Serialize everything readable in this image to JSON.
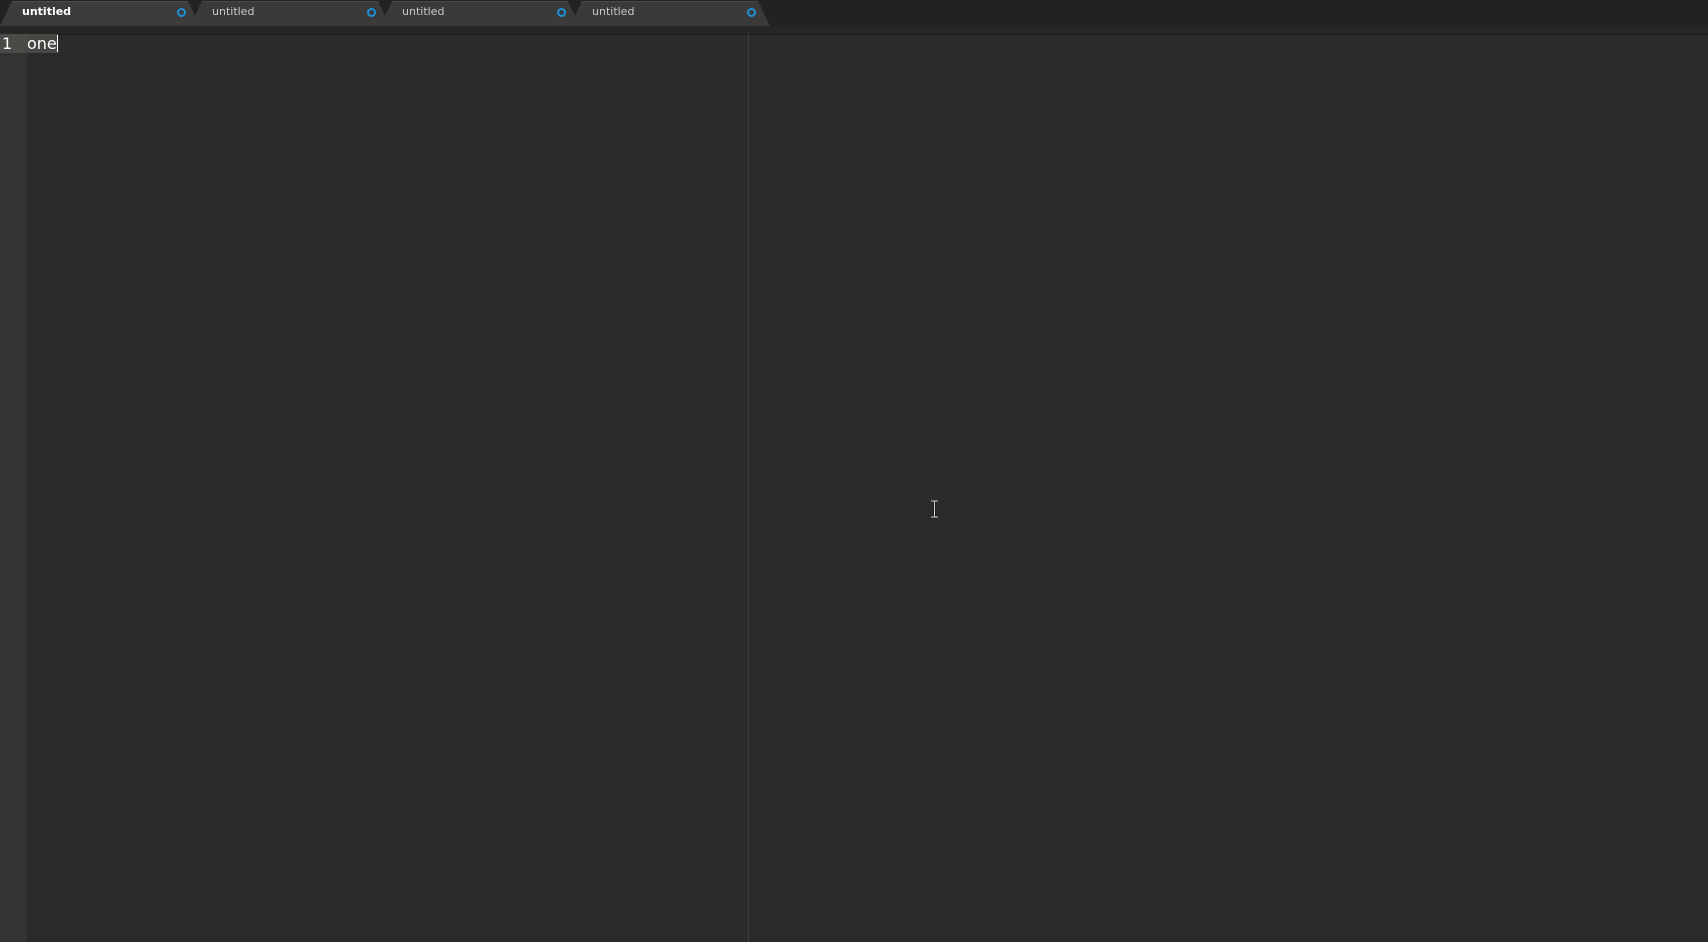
{
  "tabs": [
    {
      "label": "untitled",
      "active": true,
      "modified": true
    },
    {
      "label": "untitled",
      "active": false,
      "modified": true
    },
    {
      "label": "untitled",
      "active": false,
      "modified": true
    },
    {
      "label": "untitled",
      "active": false,
      "modified": true
    }
  ],
  "editor": {
    "lines": [
      {
        "number": "1",
        "text": "one"
      }
    ]
  },
  "colors": {
    "background": "#2b2b2b",
    "tab_modified_dot": "#1e90d8",
    "text": "#ffffff"
  },
  "icons": {
    "modified": "modified-dot-icon",
    "mouse_cursor": "ibeam-cursor-icon"
  }
}
